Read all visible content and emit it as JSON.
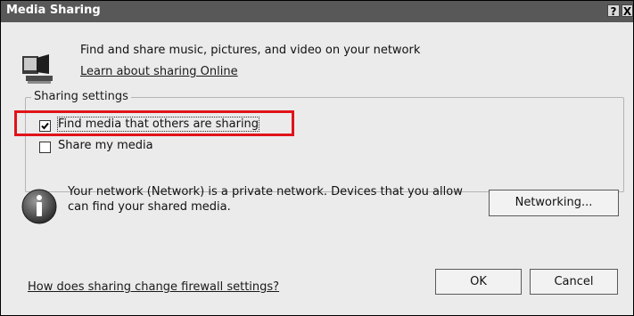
{
  "window": {
    "title": "Media Sharing",
    "help_glyph": "?",
    "close_glyph": "X"
  },
  "intro": {
    "icon": "media-computer-icon",
    "text": "Find and share music, pictures, and video on your network",
    "learn_link": "Learn about sharing Online"
  },
  "sharing_settings": {
    "group_label": "Sharing settings",
    "options": [
      {
        "label": "Find media that others are sharing",
        "checked": true
      },
      {
        "label": "Share my media",
        "checked": false
      }
    ]
  },
  "network_info": {
    "icon": "info-icon",
    "text": "Your network (Network) is a private network. Devices that you allow can find your shared media.",
    "networking_button": "Networking..."
  },
  "footer": {
    "firewall_link": "How does sharing change firewall settings?",
    "ok_button": "OK",
    "cancel_button": "Cancel"
  },
  "colors": {
    "highlight": "#e0131a",
    "titlebar": "#585858"
  }
}
